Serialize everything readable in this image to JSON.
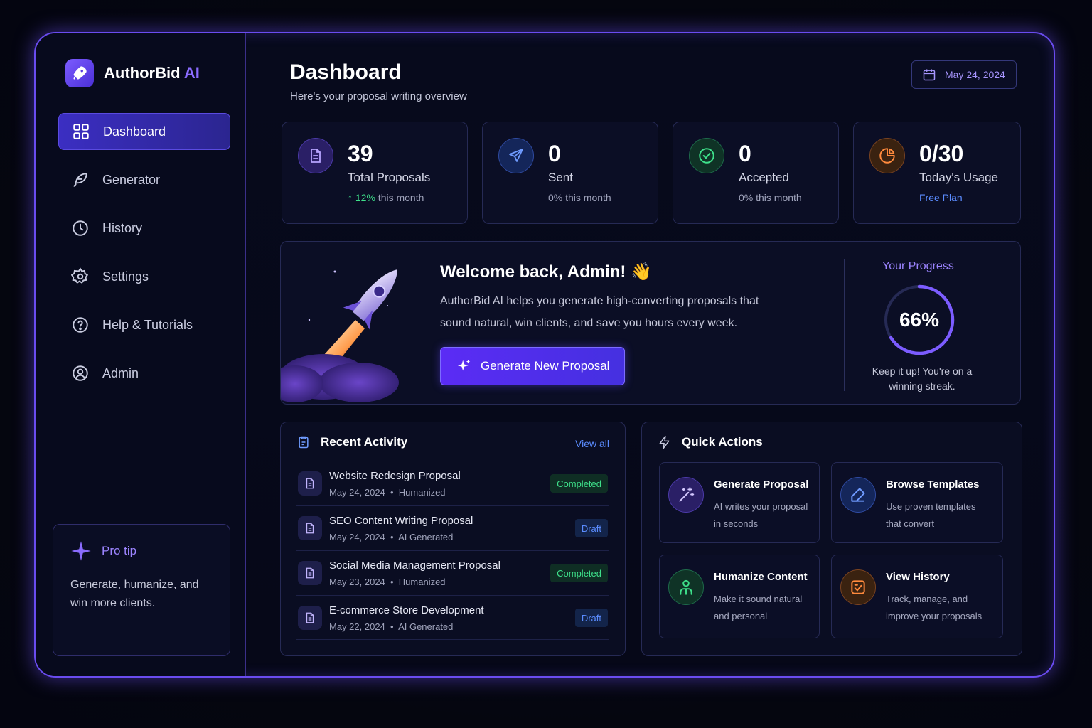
{
  "brand": {
    "name": "AuthorBid",
    "suffix": "AI"
  },
  "sidebar": {
    "items": [
      {
        "label": "Dashboard",
        "icon": "grid-icon",
        "active": true
      },
      {
        "label": "Generator",
        "icon": "feather-icon"
      },
      {
        "label": "History",
        "icon": "clock-icon"
      },
      {
        "label": "Settings",
        "icon": "gear-icon"
      },
      {
        "label": "Help & Tutorials",
        "icon": "help-circle-icon"
      },
      {
        "label": "Admin",
        "icon": "user-circle-icon"
      }
    ],
    "protip": {
      "title": "Pro tip",
      "body": "Generate, humanize, and win more clients."
    }
  },
  "header": {
    "title": "Dashboard",
    "subtitle": "Here's your proposal writing overview",
    "date": "May 24, 2024"
  },
  "stats": [
    {
      "value": "39",
      "label": "Total Proposals",
      "trend": "12%",
      "trend_suffix": " this month"
    },
    {
      "value": "0",
      "label": "Sent",
      "sub": "0% this month"
    },
    {
      "value": "0",
      "label": "Accepted",
      "sub": "0% this month"
    },
    {
      "value": "0/30",
      "label": "Today's Usage",
      "sub": "Free Plan"
    }
  ],
  "welcome": {
    "title": "Welcome back, Admin! 👋",
    "body": "AuthorBid AI helps you generate high-converting proposals that sound natural, win clients, and save you hours every week.",
    "button": "Generate New Proposal",
    "progress_title": "Your Progress",
    "progress_value": "66%",
    "progress_fraction": 0.66,
    "progress_note": "Keep it up! You're on a winning streak."
  },
  "activity": {
    "title": "Recent Activity",
    "view_all": "View all",
    "items": [
      {
        "title": "Website Redesign Proposal",
        "date": "May 24, 2024",
        "type": "Humanized",
        "status": "Completed"
      },
      {
        "title": "SEO Content Writing Proposal",
        "date": "May 24, 2024",
        "type": "AI Generated",
        "status": "Draft"
      },
      {
        "title": "Social Media Management Proposal",
        "date": "May 23, 2024",
        "type": "Humanized",
        "status": "Completed"
      },
      {
        "title": "E-commerce Store Development",
        "date": "May 22, 2024",
        "type": "AI Generated",
        "status": "Draft"
      }
    ]
  },
  "quick_actions": {
    "title": "Quick Actions",
    "items": [
      {
        "title": "Generate Proposal",
        "desc": "AI writes your proposal in seconds",
        "icon": "magic-wand-icon"
      },
      {
        "title": "Browse Templates",
        "desc": "Use proven templates that convert",
        "icon": "template-icon"
      },
      {
        "title": "Humanize Content",
        "desc": "Make it sound natural and personal",
        "icon": "people-icon"
      },
      {
        "title": "View History",
        "desc": "Track, manage, and improve your proposals",
        "icon": "history-icon"
      }
    ]
  },
  "colors": {
    "accent": "#6a4cf0",
    "success": "#3ee08a",
    "info": "#5b8cff",
    "warning": "#ff8a3d"
  }
}
